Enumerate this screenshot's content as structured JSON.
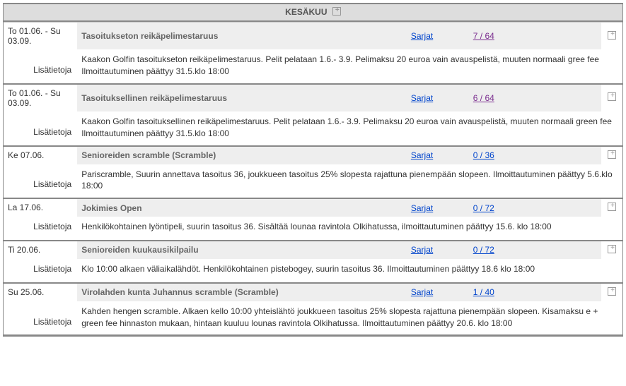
{
  "header": {
    "month": "KESÄKUU"
  },
  "labels": {
    "detail": "Lisätietoja",
    "series": "Sarjat"
  },
  "events": [
    {
      "date": "To 01.06. - Su 03.09.",
      "name": "Tasoitukseton reikäpelimestaruus",
      "count": "7 / 64",
      "countState": "visited",
      "detail": "Kaakon Golfin tasoitukseton reikäpelimestaruus. Pelit pelataan 1.6.- 3.9. Pelimaksu 20 euroa vain avauspelistä, muuten normaali gree fee Ilmoittautuminen päättyy 31.5.klo 18:00"
    },
    {
      "date": "To 01.06. - Su 03.09.",
      "name": "Tasoituksellinen reikäpelimestaruus",
      "count": "6 / 64",
      "countState": "visited",
      "detail": "Kaakon Golfin tasoituksellinen reikäpelimestaruus. Pelit pelataan 1.6.- 3.9. Pelimaksu 20 euroa vain avauspelistä, muuten normaali green fee Ilmoittautuminen päättyy 31.5.klo 18:00"
    },
    {
      "date": "Ke 07.06.",
      "name": "Senioreiden scramble (Scramble)",
      "count": "0 / 36",
      "countState": "normal",
      "detail": "Pariscramble, Suurin annettava tasoitus 36, joukkueen tasoitus 25% slopesta rajattuna pienempään slopeen. Ilmoittautuminen päättyy 5.6.klo 18:00"
    },
    {
      "date": "La 17.06.",
      "name": "Jokimies Open",
      "count": "0 / 72",
      "countState": "normal",
      "detail": "Henkilökohtainen lyöntipeli, suurin tasoitus 36. Sisältää lounaa ravintola Olkihatussa, ilmoittautuminen päättyy 15.6. klo 18:00"
    },
    {
      "date": "Ti 20.06.",
      "name": "Senioreiden kuukausikilpailu",
      "count": "0 / 72",
      "countState": "normal",
      "detail": "Klo 10:00 alkaen väliaikalähdöt. Henkilökohtainen pistebogey, suurin tasoitus 36. Ilmoittautuminen päättyy 18.6 klo 18:00"
    },
    {
      "date": "Su 25.06.",
      "name": "Virolahden kunta Juhannus scramble (Scramble)",
      "count": "1 / 40",
      "countState": "normal",
      "detail": "Kahden hengen scramble. Alkaen kello 10:00 yhteislähtö joukkueen tasoitus 25% slopesta rajattuna pienempään slopeen. Kisamaksu e + green fee hinnaston mukaan, hintaan kuuluu lounas ravintola Olkihatussa. Ilmoittautuminen päättyy 20.6. klo 18:00"
    }
  ]
}
